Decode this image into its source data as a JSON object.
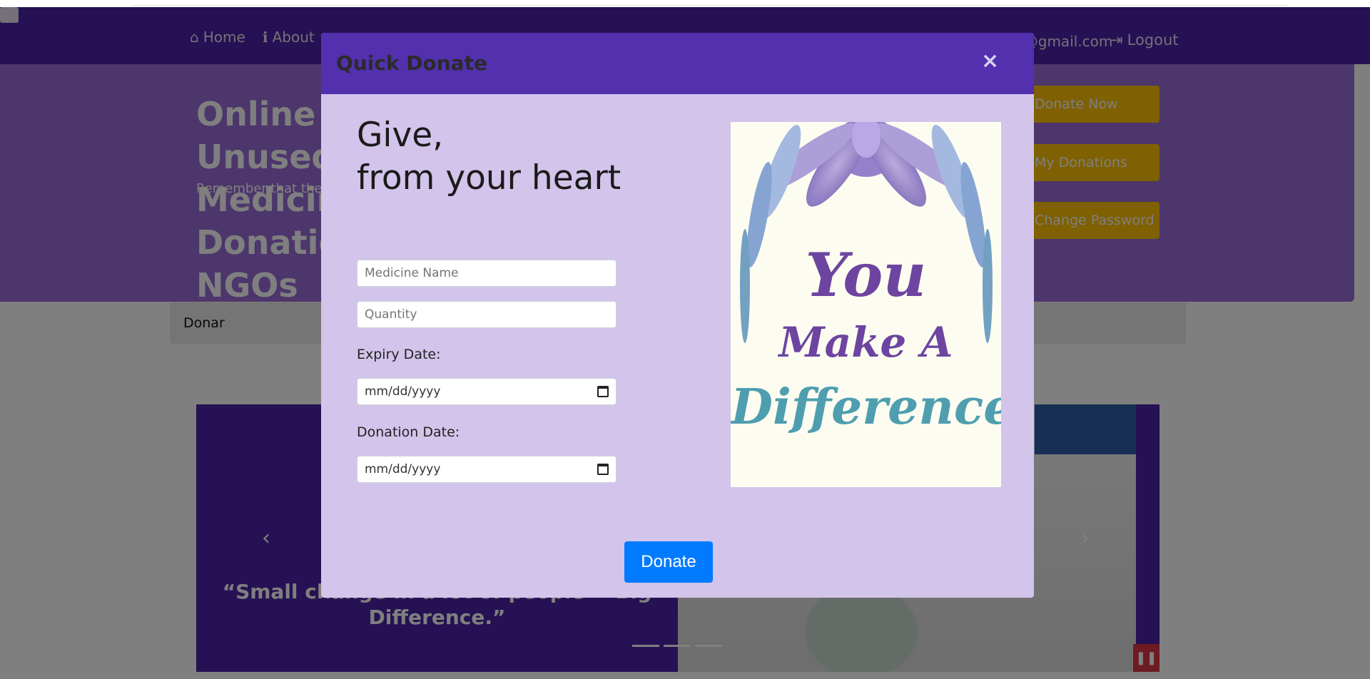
{
  "page": {
    "nav": {
      "home_label": "Home",
      "about_label": "About",
      "email": "gpatil.03032000@gmail.com",
      "logout_label": "Logout"
    },
    "hero": {
      "title": "Online Unused Medicine Donation to NGOs",
      "subtitle": "Remember that the happiest people are not those getting more",
      "buttons": [
        "Donate Now",
        "My Donations",
        "Change Password"
      ]
    },
    "tab_label": "Donar",
    "carousel": {
      "quote": "“Small change in a lot of people = Big Difference.”",
      "prev_symbol": "‹",
      "next_symbol": "›",
      "pause_symbol": "❚❚"
    }
  },
  "modal": {
    "title": "Quick Donate",
    "close_symbol": "×",
    "headline_line1": "Give,",
    "headline_line2": "from your heart",
    "medicine_placeholder": "Medicine Name",
    "quantity_placeholder": "Quantity",
    "expiry_label": "Expiry Date:",
    "expiry_value": "mm/dd/yyyy",
    "donation_label": "Donation Date:",
    "donation_value": "mm/dd/yyyy",
    "donate_button": "Donate",
    "poster": {
      "line1": "You",
      "line2": "Make A",
      "line3": "Difference"
    }
  },
  "colors": {
    "nav_bg": "#4b22a6",
    "modal_header": "#5230ae",
    "modal_body": "#d2c4ea",
    "primary_button": "#007bff",
    "accent_button": "#ffc107"
  }
}
